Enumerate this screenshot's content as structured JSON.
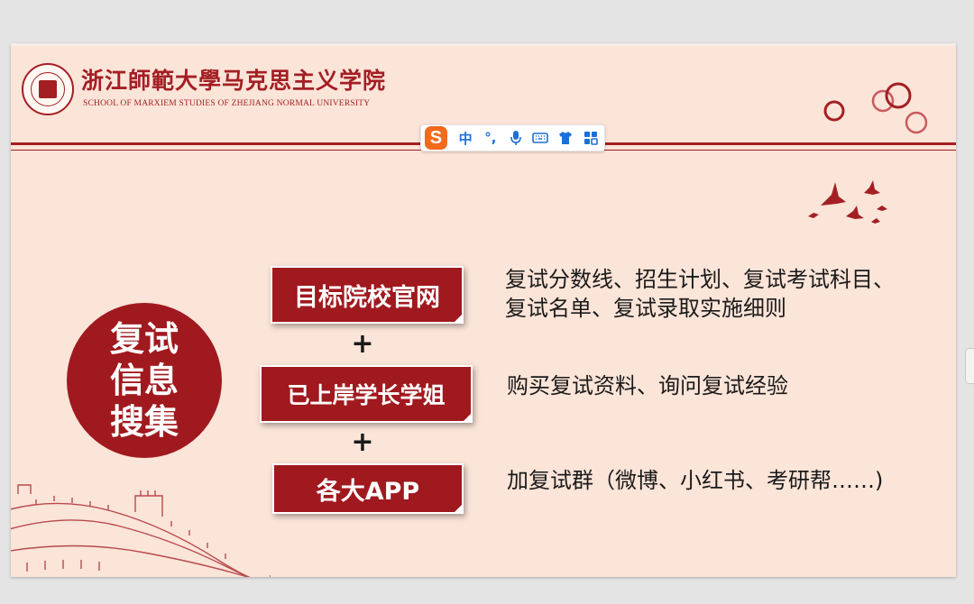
{
  "header": {
    "school_name_cn": "浙江師範大學马克思主义学院",
    "school_name_en": "SCHOOL OF MARXIEM STUDIES OF ZHEJIANG NORMAL UNIVERSITY",
    "logo_icon": "university-seal-icon"
  },
  "ime_toolbar": {
    "logo_letter": "S",
    "items": [
      {
        "name": "ime-chinese-mode",
        "label": "中"
      },
      {
        "name": "ime-punctuation",
        "label": "°,"
      },
      {
        "name": "ime-voice",
        "label": "🎤"
      },
      {
        "name": "ime-keyboard",
        "label": "⌨"
      },
      {
        "name": "ime-skin",
        "label": "👕"
      },
      {
        "name": "ime-toolbox",
        "label": "⊞"
      }
    ]
  },
  "main": {
    "circle_title_lines": [
      "复试",
      "信息",
      "搜集"
    ],
    "boxes": [
      {
        "label": "目标院校官网"
      },
      {
        "label": "已上岸学长学姐"
      },
      {
        "label": "各大APP"
      }
    ],
    "plus_sign": "+",
    "descriptions": [
      [
        "复试分数线、招生计划、复试考试科目、",
        "复试名单、复试录取实施细则"
      ],
      [
        "购买复试资料、询问复试经验"
      ],
      [
        "加复试群（微博、小红书、考研帮……)"
      ]
    ]
  },
  "colors": {
    "brand_red": "#a0191e",
    "slide_background": "#fbe4d8",
    "ime_accent": "#1d6fd6",
    "ime_logo": "#f26a1b"
  }
}
